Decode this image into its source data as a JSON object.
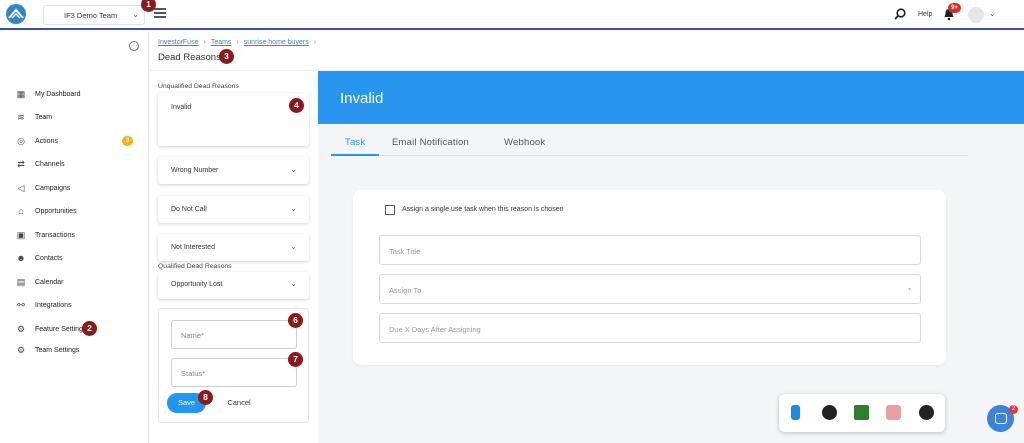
{
  "topbar": {
    "team_select": "IF3 Demo Team",
    "help_label": "Help",
    "notifications_badge": "9+"
  },
  "sidebar": {
    "items": [
      {
        "label": "My Dashboard",
        "icon": "grid-icon"
      },
      {
        "label": "Team",
        "icon": "layers-icon"
      },
      {
        "label": "Actions",
        "icon": "check-circle-icon",
        "badge": "3"
      },
      {
        "label": "Channels",
        "icon": "channels-icon"
      },
      {
        "label": "Campaigns",
        "icon": "megaphone-icon"
      },
      {
        "label": "Opportunities",
        "icon": "home-icon"
      },
      {
        "label": "Transactions",
        "icon": "money-icon"
      },
      {
        "label": "Contacts",
        "icon": "people-icon"
      },
      {
        "label": "Calendar",
        "icon": "calendar-icon"
      },
      {
        "label": "Integrations",
        "icon": "nodes-icon"
      },
      {
        "label": "Feature Settings",
        "icon": "settings-icon"
      },
      {
        "label": "Team Settings",
        "icon": "gear-icon"
      }
    ]
  },
  "breadcrumb": {
    "items": [
      "InvestorFuse",
      "Teams",
      "sunrise home buyers"
    ]
  },
  "page_title": "Dead Reasons",
  "dead_reasons": {
    "unqualified_label": "Unqualified Dead Reasons",
    "unqualified": [
      "Invalid",
      "Wrong Number",
      "Do Not Call",
      "Not Interested"
    ],
    "qualified_label": "Qualified Dead Reasons",
    "qualified": [
      "Opportunity Lost"
    ]
  },
  "new_reason_form": {
    "name_placeholder": "Name*",
    "status_placeholder": "Status*",
    "save_label": "Save",
    "cancel_label": "Cancel"
  },
  "detail": {
    "title": "Invalid",
    "tabs": [
      "Task",
      "Email Notification",
      "Webhook"
    ],
    "active_tab": "Task",
    "task": {
      "checkbox_label": "Assign a single use task when this reason is chosen",
      "task_title_placeholder": "Task Title",
      "assign_to_placeholder": "Assign To",
      "due_days_placeholder": "Due X Days After Assigning"
    }
  },
  "chat": {
    "badge": "2"
  },
  "step_markers": [
    "1",
    "2",
    "3",
    "4",
    "6",
    "7",
    "8"
  ],
  "colors": {
    "primary": "#2196f3",
    "banner": "#2896ef",
    "marker": "#8b1a1a",
    "badge_orange": "#f2b31b",
    "alert_red": "#d32f2f"
  }
}
